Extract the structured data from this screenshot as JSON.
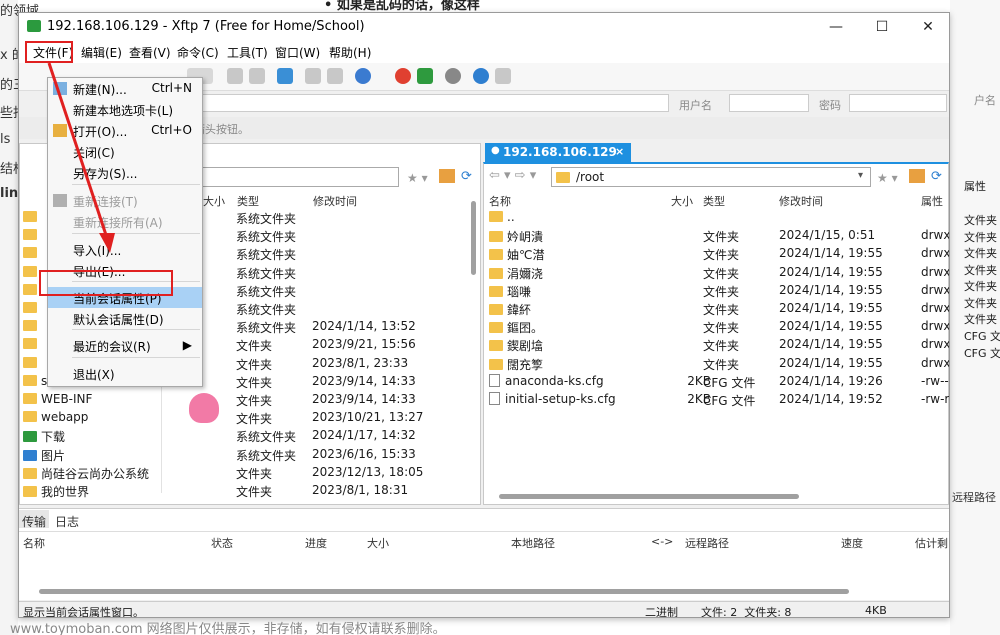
{
  "background": {
    "left_texts": [
      "的领域",
      "x 的",
      "的三",
      "些指",
      "ls",
      "结构",
      "lin"
    ],
    "heading": "• 如果是乱码的话，像这样",
    "right_labels": [
      "属性",
      "文件夹",
      "文件夹",
      "文件夹",
      "文件夹",
      "文件夹",
      "文件夹",
      "文件夹",
      "CFG 文件",
      "CFG 文件"
    ],
    "right_conn_label": "户名",
    "right_tooltip": "远程路径"
  },
  "window": {
    "title": "192.168.106.129 - Xftp 7 (Free for Home/School)",
    "controls": [
      "—",
      "☐",
      "✕"
    ]
  },
  "menubar": [
    "文件(F)",
    "编辑(E)",
    "查看(V)",
    "命令(C)",
    "工具(T)",
    "窗口(W)",
    "帮助(H)"
  ],
  "connection": {
    "username_label": "用户名",
    "password_label": "密码"
  },
  "hint": "的箭头按钮。",
  "file_menu": {
    "items": [
      {
        "label": "新建(N)...",
        "shortcut": "Ctrl+N",
        "disabled": false
      },
      {
        "label": "新建本地选项卡(L)",
        "shortcut": "",
        "disabled": false
      },
      {
        "label": "打开(O)...",
        "shortcut": "Ctrl+O",
        "disabled": false
      },
      {
        "label": "关闭(C)",
        "shortcut": "",
        "disabled": false
      },
      {
        "label": "另存为(S)...",
        "shortcut": "",
        "disabled": false
      },
      {
        "label": "重新连接(T)",
        "shortcut": "",
        "disabled": true
      },
      {
        "label": "重新连接所有(A)",
        "shortcut": "",
        "disabled": true
      },
      {
        "label": "导入(I)...",
        "shortcut": "",
        "disabled": false
      },
      {
        "label": "导出(E)...",
        "shortcut": "",
        "disabled": false
      },
      {
        "label": "当前会话属性(P)",
        "shortcut": "",
        "disabled": false
      },
      {
        "label": "默认会话属性(D)",
        "shortcut": "",
        "disabled": false
      },
      {
        "label": "最近的会议(R)",
        "shortcut": "▶",
        "disabled": false
      },
      {
        "label": "退出(X)",
        "shortcut": "",
        "disabled": false
      }
    ]
  },
  "local_pane": {
    "columns": [
      "大小",
      "类型",
      "修改时间"
    ],
    "rows": [
      {
        "name": "",
        "size": "",
        "type": "系统文件夹",
        "modified": ""
      },
      {
        "name": "",
        "size": "",
        "type": "系统文件夹",
        "modified": ""
      },
      {
        "name": "",
        "size": "",
        "type": "系统文件夹",
        "modified": ""
      },
      {
        "name": "",
        "size": "",
        "type": "系统文件夹",
        "modified": ""
      },
      {
        "name": "",
        "size": "",
        "type": "系统文件夹",
        "modified": ""
      },
      {
        "name": "",
        "size": "",
        "type": "系统文件夹",
        "modified": ""
      },
      {
        "name": "",
        "size": "",
        "type": "系统文件夹",
        "modified": "2024/1/14, 13:52"
      },
      {
        "name": "",
        "size": "",
        "type": "文件夹",
        "modified": "2023/9/21, 15:56"
      },
      {
        "name": "",
        "size": "",
        "type": "文件夹",
        "modified": "2023/8/1, 23:33"
      },
      {
        "name": "statics",
        "size": "",
        "type": "文件夹",
        "modified": "2023/9/14, 14:33"
      },
      {
        "name": "WEB-INF",
        "size": "",
        "type": "文件夹",
        "modified": "2023/9/14, 14:33"
      },
      {
        "name": "webapp",
        "size": "",
        "type": "文件夹",
        "modified": "2023/10/21, 13:27"
      },
      {
        "name": "下载",
        "size": "",
        "type": "系统文件夹",
        "modified": "2024/1/17, 14:32"
      },
      {
        "name": "图片",
        "size": "",
        "type": "系统文件夹",
        "modified": "2023/6/16, 15:33"
      },
      {
        "name": "尚硅谷云尚办公系统",
        "size": "",
        "type": "文件夹",
        "modified": "2023/12/13, 18:05"
      },
      {
        "name": "我的世界",
        "size": "",
        "type": "文件夹",
        "modified": "2023/8/1, 18:31"
      }
    ]
  },
  "remote_pane": {
    "tab_label": "192.168.106.129",
    "path": "/root",
    "columns": [
      "名称",
      "大小",
      "类型",
      "修改时间",
      "属性"
    ],
    "rows": [
      {
        "name": "..",
        "size": "",
        "type": "",
        "modified": "",
        "attr": "",
        "kind": "folder"
      },
      {
        "name": "妗岄潰",
        "size": "",
        "type": "文件夹",
        "modified": "2024/1/15, 0:51",
        "attr": "drwxr",
        "kind": "folder"
      },
      {
        "name": "妯℃澘",
        "size": "",
        "type": "文件夹",
        "modified": "2024/1/14, 19:55",
        "attr": "drwxr",
        "kind": "folder"
      },
      {
        "name": "涓嬭浇",
        "size": "",
        "type": "文件夹",
        "modified": "2024/1/14, 19:55",
        "attr": "drwxr",
        "kind": "folder"
      },
      {
        "name": "瑙嗛",
        "size": "",
        "type": "文件夹",
        "modified": "2024/1/14, 19:55",
        "attr": "drwxr",
        "kind": "folder"
      },
      {
        "name": "鍏紑",
        "size": "",
        "type": "文件夹",
        "modified": "2024/1/14, 19:55",
        "attr": "drwxr",
        "kind": "folder"
      },
      {
        "name": "鏂囨。",
        "size": "",
        "type": "文件夹",
        "modified": "2024/1/14, 19:55",
        "attr": "drwxr",
        "kind": "folder"
      },
      {
        "name": "鍥剧墖",
        "size": "",
        "type": "文件夹",
        "modified": "2024/1/14, 19:55",
        "attr": "drwxr",
        "kind": "folder"
      },
      {
        "name": "闊充箰",
        "size": "",
        "type": "文件夹",
        "modified": "2024/1/14, 19:55",
        "attr": "drwxr",
        "kind": "folder"
      },
      {
        "name": "anaconda-ks.cfg",
        "size": "2KB",
        "type": "CFG 文件",
        "modified": "2024/1/14, 19:26",
        "attr": "-rw--",
        "kind": "file"
      },
      {
        "name": "initial-setup-ks.cfg",
        "size": "2KB",
        "type": "CFG 文件",
        "modified": "2024/1/14, 19:52",
        "attr": "-rw-r-",
        "kind": "file"
      }
    ]
  },
  "transfer": {
    "tabs": [
      "传输",
      "日志"
    ],
    "columns": [
      "名称",
      "状态",
      "进度",
      "大小",
      "本地路径",
      "<->",
      "远程路径",
      "速度",
      "估计剩"
    ]
  },
  "status": {
    "message": "显示当前会话属性窗口。",
    "mode": "二进制",
    "counts": "文件: 2  文件夹: 8",
    "size": "4KB"
  },
  "watermark": "www.toymoban.com 网络图片仅供展示，非存储，如有侵权请联系删除。",
  "colors": {
    "accent": "#1e90e0",
    "highlight": "#e02020",
    "folder": "#f3c24a"
  }
}
